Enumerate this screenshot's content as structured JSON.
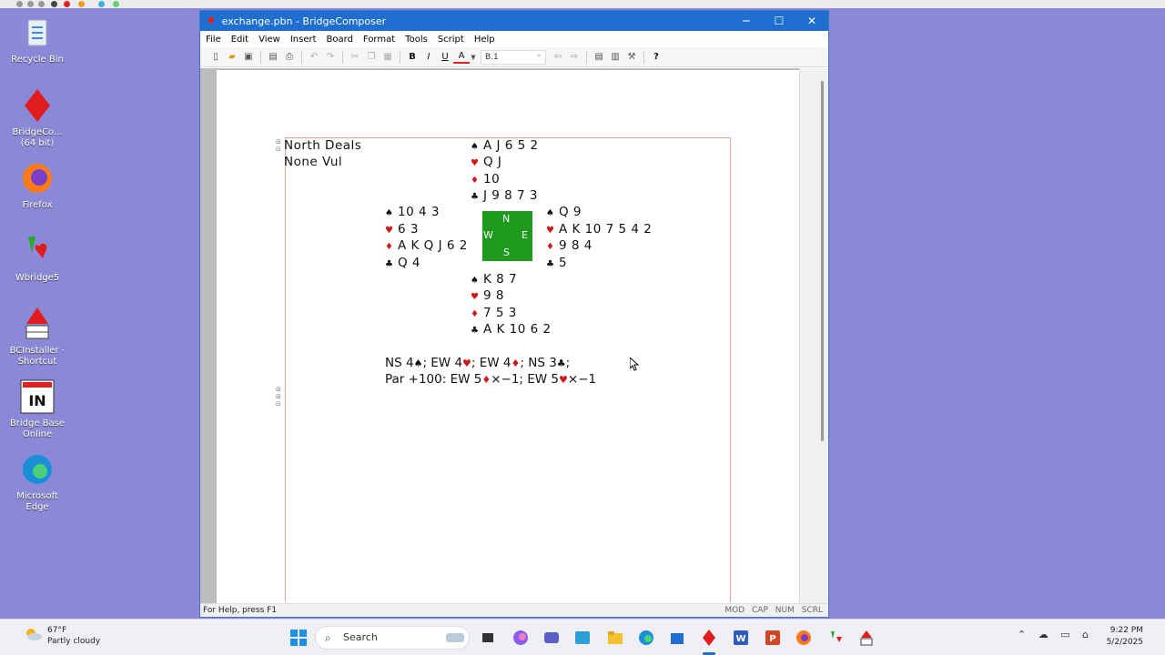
{
  "desktop": {
    "icons": [
      {
        "label": "Recycle Bin"
      },
      {
        "label": "BridgeCo... (64 bit)"
      },
      {
        "label": "Firefox"
      },
      {
        "label": "Wbridge5"
      },
      {
        "label": "BCInstaller - Shortcut"
      },
      {
        "label": "Bridge Base Online"
      },
      {
        "label": "Microsoft Edge"
      }
    ]
  },
  "window": {
    "title": "exchange.pbn - BridgeComposer",
    "menu": [
      "File",
      "Edit",
      "View",
      "Insert",
      "Board",
      "Format",
      "Tools",
      "Script",
      "Help"
    ],
    "board_combo": "B.1",
    "status": "For Help, press F1",
    "indicators": [
      "MOD",
      "CAP",
      "NUM",
      "SCRL"
    ]
  },
  "deal": {
    "dealer": "North Deals",
    "vul": "None Vul",
    "north": {
      "spades": "A J 6 5 2",
      "hearts": "Q J",
      "diamonds": "10",
      "clubs": "J 9 8 7 3"
    },
    "west": {
      "spades": "10 4 3",
      "hearts": "6 3",
      "diamonds": "A K Q J 6 2",
      "clubs": "Q 4"
    },
    "east": {
      "spades": "Q 9",
      "hearts": "A K 10 7 5 4 2",
      "diamonds": "9 8 4",
      "clubs": "5"
    },
    "south": {
      "spades": "K 8 7",
      "hearts": "9 8",
      "diamonds": "7 5 3",
      "clubs": "A K 10 6 2"
    },
    "compass": {
      "n": "N",
      "e": "E",
      "s": "S",
      "w": "W"
    },
    "makes": {
      "ns1": "NS 4",
      "ew1": "; EW 4",
      "ew2": "; EW 4",
      "ns2": "; NS 3",
      "end": ";"
    },
    "par": {
      "prefix": "Par +100: EW 5",
      "mid": "×−1; EW 5",
      "end": "×−1"
    }
  },
  "taskbar": {
    "weather_temp": "67°F",
    "weather_desc": "Partly cloudy",
    "search": "Search",
    "time": "9:22 PM",
    "date": "5/2/2025"
  },
  "colors": {
    "felt": "#1e9a1e",
    "red_suit": "#d01818",
    "titlebar": "#1e6fd0",
    "desktop": "#8b88d8"
  }
}
